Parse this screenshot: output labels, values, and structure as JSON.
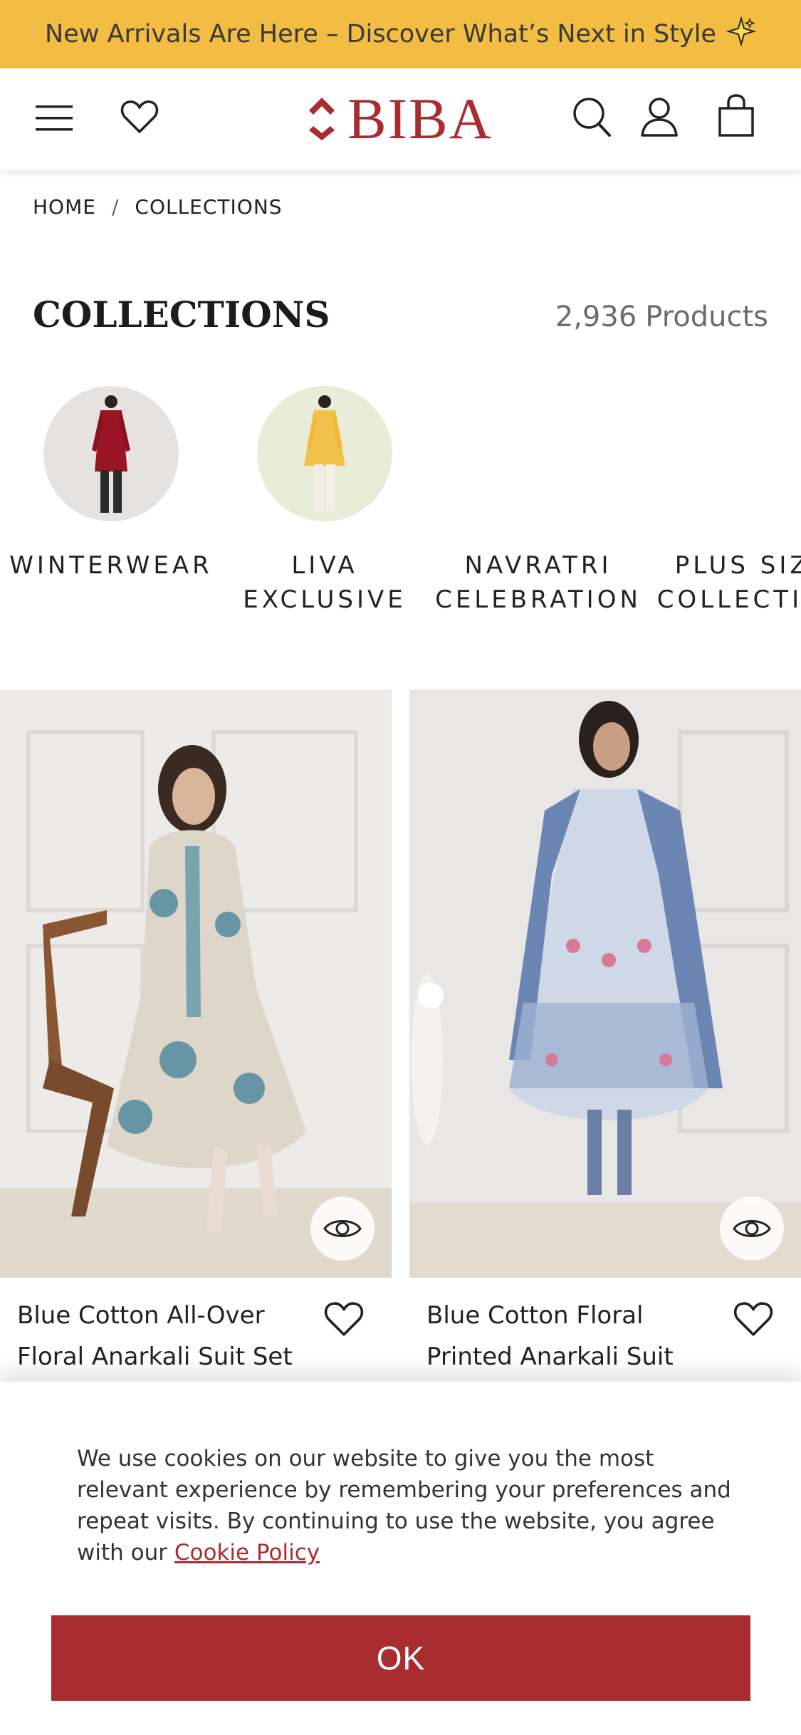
{
  "announcement": {
    "text": "New Arrivals Are Here – Discover What’s Next in Style",
    "icon": "sparkle-icon"
  },
  "header": {
    "menu_icon": "hamburger-menu-icon",
    "wishlist_icon": "heart-icon",
    "logo_text": "BIBA",
    "search_icon": "search-icon",
    "account_icon": "user-icon",
    "bag_icon": "shopping-bag-icon"
  },
  "breadcrumb": {
    "items": [
      "HOME",
      "COLLECTIONS"
    ],
    "separator": "/"
  },
  "page": {
    "title": "COLLECTIONS",
    "product_count": "2,936",
    "product_count_label": "Products"
  },
  "categories": [
    {
      "label": "WINTERWEAR"
    },
    {
      "label": "LIVA\nEXCLUSIVE"
    },
    {
      "label": "NAVRATRI\nCELEBRATION"
    },
    {
      "label": "PLUS SIZE\nCOLLECTION"
    }
  ],
  "products": [
    {
      "name": "Blue Cotton All-Over Floral Anarkali Suit Set"
    },
    {
      "name": "Blue Cotton Floral Printed Anarkali Suit"
    }
  ],
  "cookie": {
    "text": "We use cookies on our website to give you the most relevant experience by remembering your preferences and repeat visits. By continuing to use the website, you agree with our",
    "link_text": "Cookie Policy",
    "button_label": "OK"
  },
  "colors": {
    "announcement_bg": "#f2bd42",
    "brand": "#a82c30",
    "text": "#1a1a1a",
    "muted": "#6b6b6b"
  }
}
